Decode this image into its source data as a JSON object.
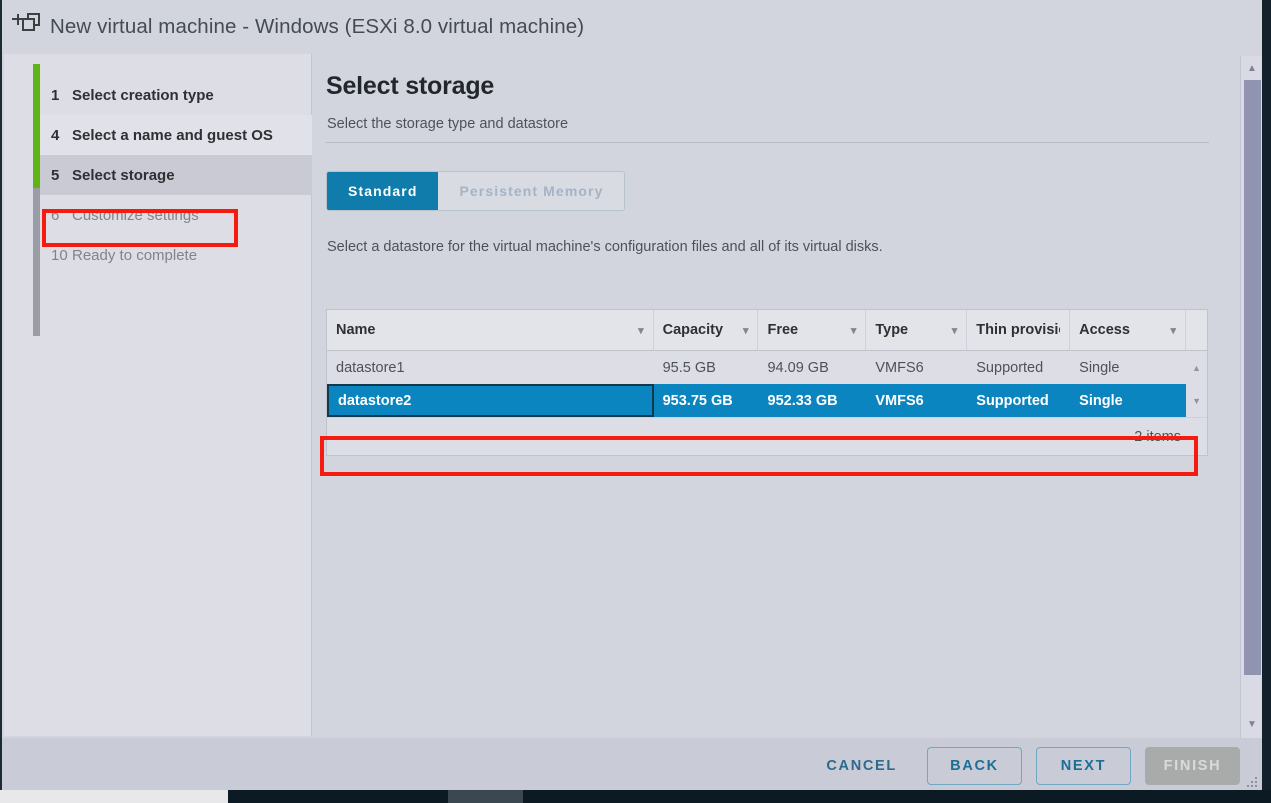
{
  "window": {
    "title": "New virtual machine - Windows (ESXi 8.0 virtual machine)",
    "icon": "new-virtual-machine-icon"
  },
  "sidebar": {
    "steps": [
      {
        "num": "1",
        "label": "Select creation type",
        "state": "done"
      },
      {
        "num": "4",
        "label": "Select a name and guest OS",
        "state": "hovered"
      },
      {
        "num": "5",
        "label": "Select storage",
        "state": "current"
      },
      {
        "num": "6",
        "label": "Customize settings",
        "state": "pending"
      },
      {
        "num": "10",
        "label": "Ready to complete",
        "state": "pending"
      }
    ],
    "rail_active_color": "#60b515",
    "rail_inactive_color": "#9a9ca6"
  },
  "content": {
    "title": "Select storage",
    "subtitle": "Select the storage type and datastore",
    "tabs": [
      {
        "label": "Standard",
        "state": "active"
      },
      {
        "label": "Persistent Memory",
        "state": "disabled"
      }
    ],
    "hint": "Select a datastore for the virtual machine's configuration files and all of its virtual disks.",
    "accent_color": "#0f7cac"
  },
  "table": {
    "columns": [
      {
        "label": "Name",
        "sortable": true,
        "icon": "chevron-down-icon"
      },
      {
        "label": "Capacity",
        "sortable": true,
        "icon": "chevron-down-icon"
      },
      {
        "label": "Free",
        "sortable": true,
        "icon": "chevron-down-icon"
      },
      {
        "label": "Type",
        "sortable": true,
        "icon": "chevron-down-icon"
      },
      {
        "label": "Thin provisio",
        "sortable": false,
        "icon": ""
      },
      {
        "label": "Access",
        "sortable": true,
        "icon": "chevron-down-icon"
      }
    ],
    "rows": [
      {
        "name": "datastore1",
        "capacity": "95.5 GB",
        "free": "94.09 GB",
        "type": "VMFS6",
        "thin": "Supported",
        "access": "Single",
        "selected": false
      },
      {
        "name": "datastore2",
        "capacity": "953.75 GB",
        "free": "952.33 GB",
        "type": "VMFS6",
        "thin": "Supported",
        "access": "Single",
        "selected": true
      }
    ],
    "item_count_label": "2 items",
    "scroll_up_icon": "triangle-up-icon",
    "scroll_down_icon": "triangle-down-icon",
    "selected_row_color": "#0a85c0"
  },
  "footer": {
    "cancel_label": "CANCEL",
    "back_label": "BACK",
    "next_label": "NEXT",
    "finish_label": "FINISH"
  },
  "annotations": {
    "highlight_color": "#f51b0e",
    "step_box": "Select storage",
    "row_box": "datastore2"
  },
  "scrollbar": {
    "up_icon": "triangle-up-icon",
    "down_icon": "triangle-down-icon"
  }
}
